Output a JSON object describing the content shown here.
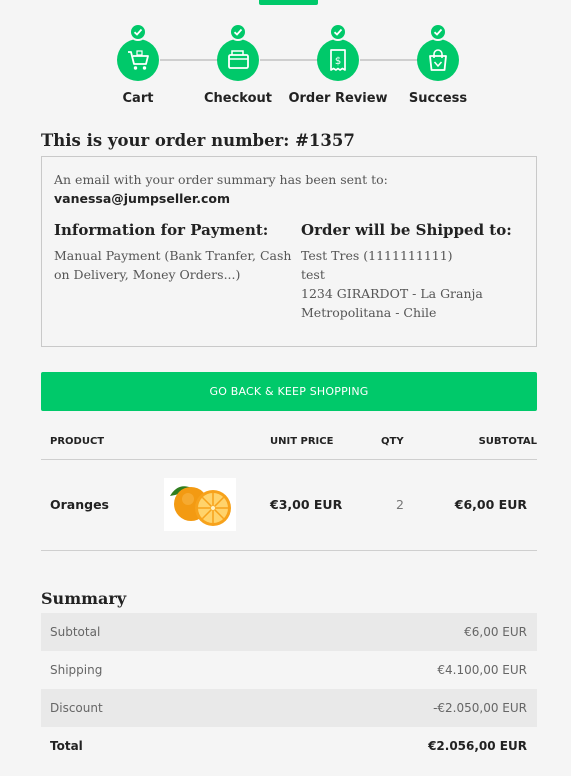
{
  "steps": [
    {
      "label": "Cart",
      "icon": "cart-icon"
    },
    {
      "label": "Checkout",
      "icon": "wallet-icon"
    },
    {
      "label": "Order Review",
      "icon": "receipt-icon"
    },
    {
      "label": "Success",
      "icon": "shopping-bag-icon"
    }
  ],
  "order": {
    "title": "This is your order number: #1357",
    "email_note": "An email with your order summary has been sent to:",
    "email": "vanessa@jumpseller.com",
    "payment_title": "Information for Payment:",
    "payment_lines": [
      "Manual Payment (Bank Tranfer, Cash",
      "on Delivery, Money Orders...)"
    ],
    "shipping_title": "Order will be Shipped to:",
    "shipping_lines": [
      "Test Tres (1111111111)",
      "test",
      "1234 GIRARDOT - La Granja",
      "Metropolitana - Chile"
    ]
  },
  "keep_shopping_label": "GO BACK & KEEP SHOPPING",
  "table": {
    "headers": {
      "product": "PRODUCT",
      "unit_price": "UNIT PRICE",
      "qty": "QTY",
      "subtotal": "SUBTOTAL"
    },
    "rows": [
      {
        "product": "Oranges",
        "image": "oranges-image",
        "unit_price": "€3,00 EUR",
        "qty": "2",
        "subtotal": "€6,00 EUR"
      }
    ]
  },
  "summary": {
    "title": "Summary",
    "rows": [
      {
        "label": "Subtotal",
        "value": "€6,00 EUR"
      },
      {
        "label": "Shipping",
        "value": "€4.100,00 EUR"
      },
      {
        "label": "Discount",
        "value": "-€2.050,00 EUR"
      },
      {
        "label": "Total",
        "value": "€2.056,00 EUR"
      }
    ]
  },
  "colors": {
    "accent": "#00c96a",
    "background": "#f5f5f5"
  }
}
